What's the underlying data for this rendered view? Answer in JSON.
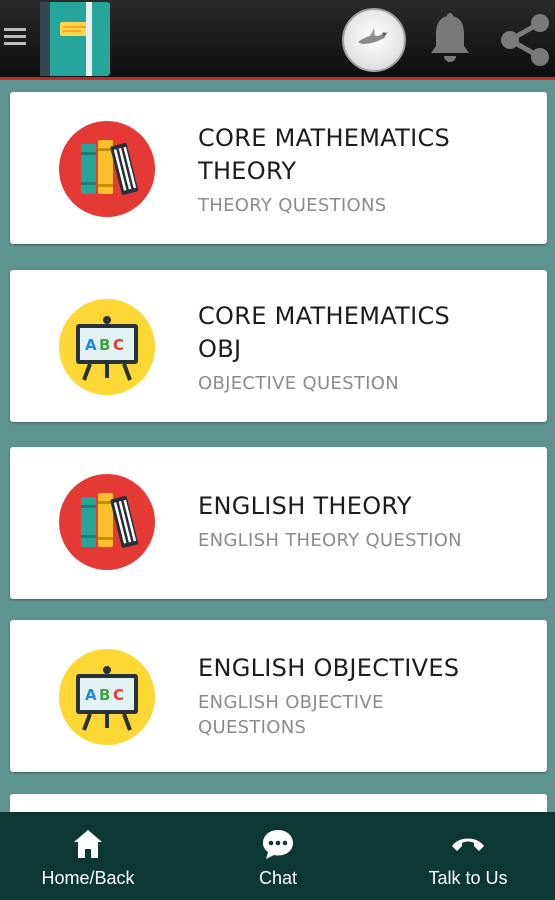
{
  "header": {
    "menu_icon": "hamburger-menu-icon",
    "logo_icon": "notebook-logo-icon",
    "avatar_icon": "profile-avatar-icon",
    "notifications_icon": "bell-icon",
    "share_icon": "share-icon",
    "colors": {
      "bar": "#1a1a1a",
      "accent_line": "#c62828"
    }
  },
  "cards": [
    {
      "icon": "books-icon",
      "title_line1": "CORE MATHEMATICS",
      "title_line2": "THEORY",
      "subtitle_line1": "THEORY QUESTIONS",
      "subtitle_line2": ""
    },
    {
      "icon": "abc-board-icon",
      "title_line1": "CORE MATHEMATICS",
      "title_line2": "OBJ",
      "subtitle_line1": "OBJECTIVE QUESTION",
      "subtitle_line2": ""
    },
    {
      "icon": "books-icon",
      "title_line1": "ENGLISH THEORY",
      "title_line2": "",
      "subtitle_line1": "ENGLISH THEORY QUESTION",
      "subtitle_line2": ""
    },
    {
      "icon": "abc-board-icon",
      "title_line1": "ENGLISH OBJECTIVES",
      "title_line2": "",
      "subtitle_line1": "ENGLISH OBJECTIVE",
      "subtitle_line2": "QUESTIONS"
    }
  ],
  "board_text": "ABC",
  "bottom_nav": {
    "home": {
      "label": "Home/Back",
      "icon": "home-icon"
    },
    "chat": {
      "label": "Chat",
      "icon": "chat-bubble-icon"
    },
    "talk": {
      "label": "Talk to Us",
      "icon": "phone-icon"
    }
  },
  "colors": {
    "background": "#5e9490",
    "bottom_nav": "#0b3833",
    "books_circle": "#e53935",
    "board_circle": "#fdd835"
  }
}
